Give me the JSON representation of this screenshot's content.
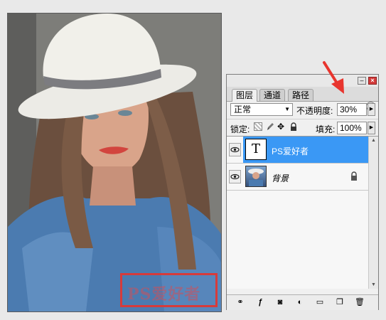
{
  "panel": {
    "tabs": [
      "图层",
      "通道",
      "路径"
    ],
    "blend_mode": "正常",
    "opacity_label": "不透明度:",
    "opacity_value": "30%",
    "lock_label": "锁定:",
    "fill_label": "填充:",
    "fill_value": "100%",
    "layers": [
      {
        "name": "PS爱好者",
        "type": "text",
        "thumb_glyph": "T",
        "selected": true
      },
      {
        "name": "背景",
        "type": "image",
        "locked": true
      }
    ]
  },
  "photo": {
    "watermark": "PS爱好者"
  },
  "colors": {
    "selection": "#3a98f5",
    "arrow": "#e8352e",
    "watermark_box": "#d63b3b"
  },
  "icons": [
    "eye-icon",
    "lock-icon",
    "move-icon",
    "brush-icon",
    "link-icon",
    "fx-icon",
    "mask-icon",
    "adjustment-icon",
    "folder-icon",
    "new-layer-icon",
    "trash-icon",
    "panel-menu-icon"
  ]
}
